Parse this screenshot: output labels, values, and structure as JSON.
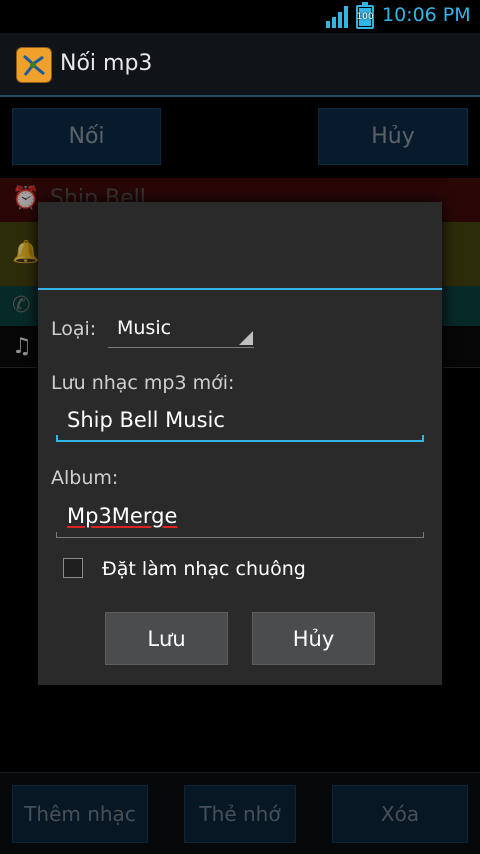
{
  "status_bar": {
    "time": "10:06 PM",
    "battery_level": "100"
  },
  "app": {
    "title": "Nối mp3"
  },
  "top_actions": {
    "join_label": "Nối",
    "cancel_label": "Hủy"
  },
  "list": {
    "first_item_label": "Ship Bell"
  },
  "bottom_actions": {
    "add_music_label": "Thêm nhạc",
    "memory_card_label": "Thẻ nhớ",
    "delete_label": "Xóa"
  },
  "dialog": {
    "type_label": "Loại:",
    "type_value": "Music",
    "save_label": "Lưu nhạc mp3 mới:",
    "filename_value": "Ship Bell Music",
    "album_label": "Album:",
    "album_value": "Mp3Merge",
    "ringtone_label": "Đặt làm nhạc chuông",
    "ringtone_checked": false,
    "save_button": "Lưu",
    "cancel_button": "Hủy"
  },
  "colors": {
    "accent": "#33b5e5",
    "dialog_bg": "#2a2a2b"
  }
}
